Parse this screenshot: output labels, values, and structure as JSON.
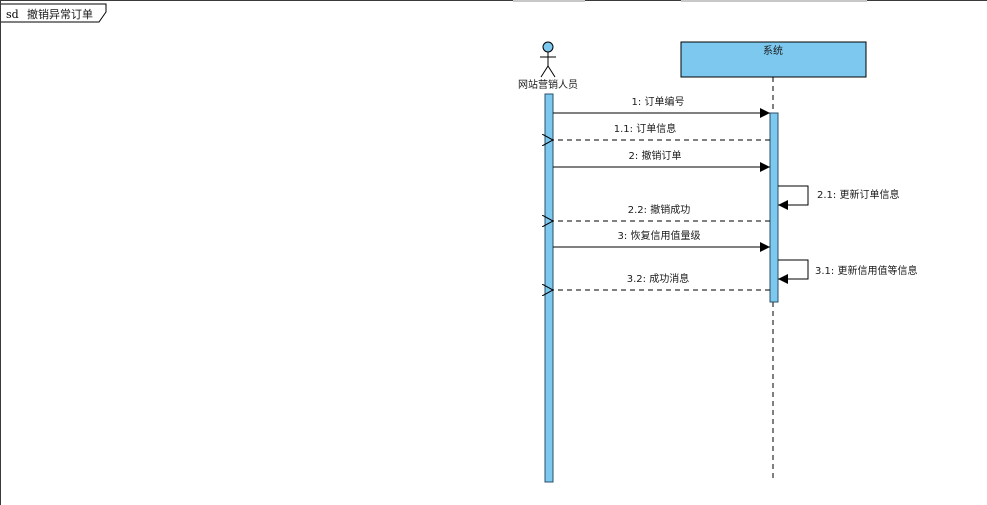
{
  "frame": {
    "keyword": "sd",
    "title": "撤销异常订单"
  },
  "lifelines": {
    "actor": {
      "name": "网站营销人员"
    },
    "system": {
      "name": "系统"
    }
  },
  "messages": [
    {
      "id": "m1",
      "label": "1: 订单编号",
      "kind": "sync"
    },
    {
      "id": "m11",
      "label": "1.1: 订单信息",
      "kind": "return"
    },
    {
      "id": "m2",
      "label": "2: 撤销订单",
      "kind": "sync"
    },
    {
      "id": "m21",
      "label": "2.1: 更新订单信息",
      "kind": "self"
    },
    {
      "id": "m22",
      "label": "2.2: 撤销成功",
      "kind": "return"
    },
    {
      "id": "m3",
      "label": "3: 恢复信用值量级",
      "kind": "sync"
    },
    {
      "id": "m31",
      "label": "3.1: 更新信用值等信息",
      "kind": "self"
    },
    {
      "id": "m32",
      "label": "3.2: 成功消息",
      "kind": "return"
    }
  ],
  "colors": {
    "activation": "#7cc8ef",
    "activation_border": "#2a4f66",
    "line": "#000000"
  }
}
